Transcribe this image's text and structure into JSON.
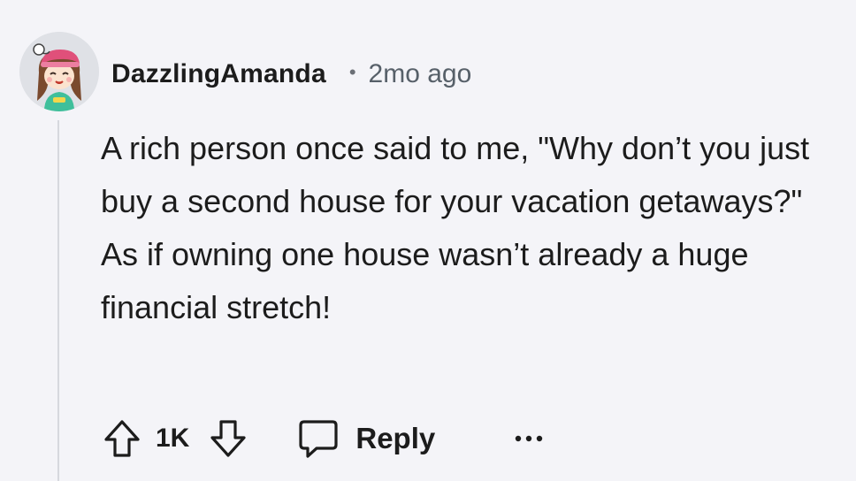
{
  "comment": {
    "username": "DazzlingAmanda",
    "separator": "•",
    "timestamp": "2mo ago",
    "body": "A rich person once said to me, \"Why don’t you just buy a second house for your vacation getaways?\" As if owning one house wasn’t already a huge financial stretch!",
    "vote_count": "1K",
    "reply_label": "Reply"
  },
  "icons": {
    "avatar": "snoovatar-icon",
    "upvote": "arrow-up-icon",
    "downvote": "arrow-down-icon",
    "reply": "speech-bubble-icon",
    "more": "ellipsis-icon"
  },
  "colors": {
    "background": "#f4f4f8",
    "text": "#1c1c1c",
    "meta": "#576069"
  }
}
